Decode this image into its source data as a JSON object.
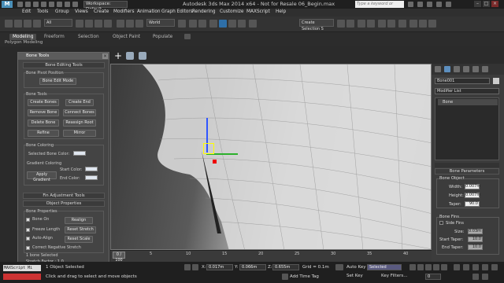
{
  "titlebar": {
    "workspace": "Workspace: Default",
    "title": "Autodesk 3ds Max  2014 x64  - Not for Resale   06_Begin.max",
    "search_placeholder": "Type a keyword or phrase"
  },
  "menu": [
    "Edit",
    "Tools",
    "Group",
    "Views",
    "Create",
    "Modifiers",
    "Animation",
    "Graph Editors",
    "Rendering",
    "Customize",
    "MAXScript",
    "Help"
  ],
  "toolbar": {
    "filter_value": "All",
    "refcoord_value": "World",
    "selection_set": "Create Selection S"
  },
  "ribbon": {
    "tabs": [
      "Modeling",
      "Freeform",
      "Selection",
      "Object Paint",
      "Populate"
    ],
    "active_tab": "Modeling",
    "sub_label": "Polygon Modeling"
  },
  "bone_tools": {
    "title": "Bone Tools",
    "editing_header": "Bone Editing Tools",
    "pivot_group": "Bone Pivot Position",
    "bone_edit_mode": "Bone Edit Mode",
    "tools_group": "Bone Tools",
    "create_bones": "Create Bones",
    "create_end": "Create End",
    "remove_bone": "Remove Bone",
    "connect_bones": "Connect Bones",
    "delete_bone": "Delete Bone",
    "reassign_root": "Reassign Root",
    "refine": "Refine",
    "mirror": "Mirror",
    "coloring_group": "Bone Coloring",
    "selected_bone_color": "Selected Bone Color:",
    "gradient_coloring": "Gradient Coloring",
    "apply_gradient": "Apply Gradient",
    "start_color": "Start Color:",
    "end_color": "End Color:",
    "fin_header": "Fin Adjustment Tools",
    "object_props_header": "Object Properties",
    "bone_props_group": "Bone Properties",
    "bone_on": "Bone On",
    "realign": "Realign",
    "freeze_length": "Freeze Length",
    "reset_stretch": "Reset Stretch",
    "auto_align": "Auto-Align",
    "reset_scale": "Reset Scale",
    "correct_neg_stretch": "Correct Negative Stretch",
    "selected_info": "1 bone Selected",
    "stretch_factor": "Stretch Factor : 1.0"
  },
  "command_panel": {
    "object_name": "Bone001",
    "modifier_list": "Modifier List",
    "stack_item": "Bone",
    "params_header": "Bone Parameters",
    "bone_object_group": "Bone Object",
    "width_label": "Width:",
    "width_value": "0.007m",
    "height_label": "Height:",
    "height_value": "0.007m",
    "taper_label": "Taper:",
    "taper_value": "90.0",
    "bone_fins_group": "Bone Fins",
    "side_fins": "Side Fins",
    "size_label": "Size:",
    "size_value": "0.03m",
    "start_taper_label": "Start Taper:",
    "start_taper_value": "10.0",
    "end_taper_label": "End Taper:",
    "end_taper_value": "10.0"
  },
  "timeline": {
    "slider": "0 / 100",
    "ticks": [
      "0",
      "5",
      "10",
      "15",
      "20",
      "25",
      "30",
      "35",
      "40",
      "45"
    ]
  },
  "status": {
    "maxscript": "MAXScript Mi",
    "selected": "1 Object Selected",
    "prompt": "Click and drag to select and move objects",
    "x_label": "X:",
    "x_value": "0.017m",
    "y_label": "Y:",
    "y_value": "0.066m",
    "z_label": "Z:",
    "z_value": "0.655m",
    "grid": "Grid = 0.1m",
    "add_time_tag": "Add Time Tag",
    "auto_key": "Auto Key",
    "set_key": "Set Key",
    "selected_dropdown": "Selected",
    "key_filters": "Key Filters...",
    "frame": "0"
  }
}
